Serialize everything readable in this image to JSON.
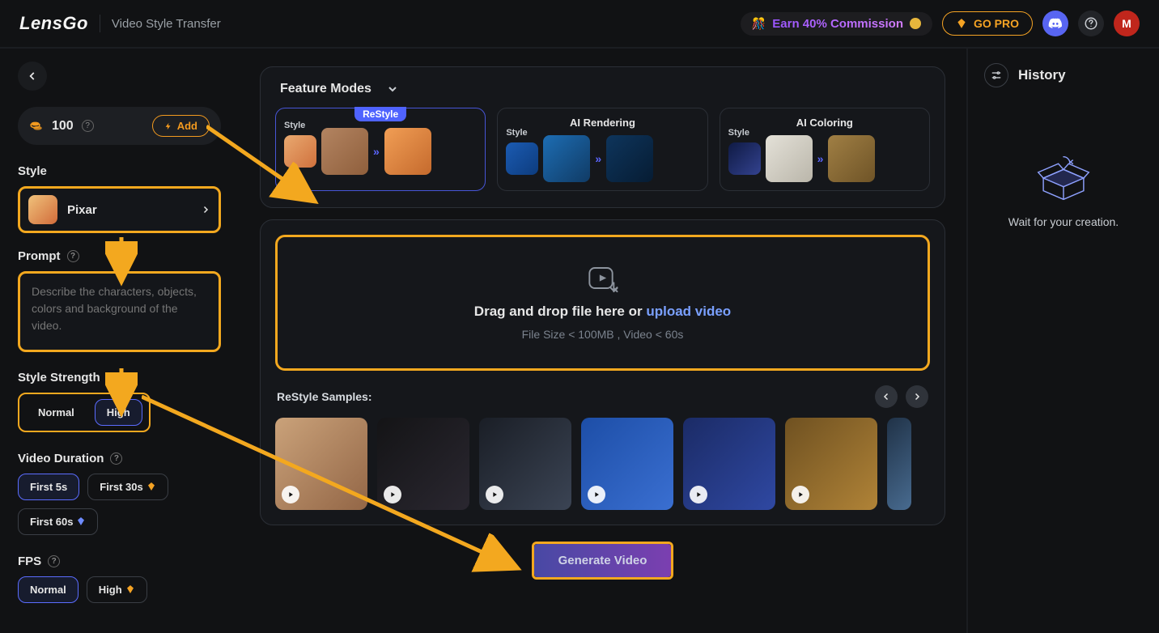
{
  "header": {
    "logo": "LensGo",
    "subtitle": "Video Style Transfer",
    "commission_text": "Earn 40% Commission",
    "gopro": "GO PRO",
    "avatar_initial": "M"
  },
  "sidebar": {
    "credits": "100",
    "add_label": "Add",
    "style": {
      "label": "Style",
      "selected": "Pixar"
    },
    "prompt": {
      "label": "Prompt",
      "placeholder": "Describe the characters, objects, colors and background of the video."
    },
    "strength": {
      "label": "Style Strength",
      "options": [
        "Normal",
        "High"
      ],
      "selected": "High"
    },
    "duration": {
      "label": "Video Duration",
      "options": [
        "First 5s",
        "First 30s",
        "First 60s"
      ],
      "selected": "First 5s"
    },
    "fps": {
      "label": "FPS",
      "options": [
        "Normal",
        "High"
      ],
      "selected": "Normal"
    }
  },
  "main": {
    "feature_modes_label": "Feature Modes",
    "modes": [
      {
        "title": "ReStyle",
        "badge": "ReStyle",
        "selected": true,
        "style_label": "Style"
      },
      {
        "title": "AI Rendering",
        "selected": false,
        "style_label": "Style"
      },
      {
        "title": "AI Coloring",
        "selected": false,
        "style_label": "Style"
      }
    ],
    "dropzone": {
      "main_before": "Drag and drop file here or ",
      "link": "upload video",
      "sub": "File Size < 100MB , Video < 60s"
    },
    "samples_label": "ReStyle Samples:",
    "generate_label": "Generate Video"
  },
  "rightbar": {
    "history": "History",
    "wait": "Wait for your creation."
  }
}
